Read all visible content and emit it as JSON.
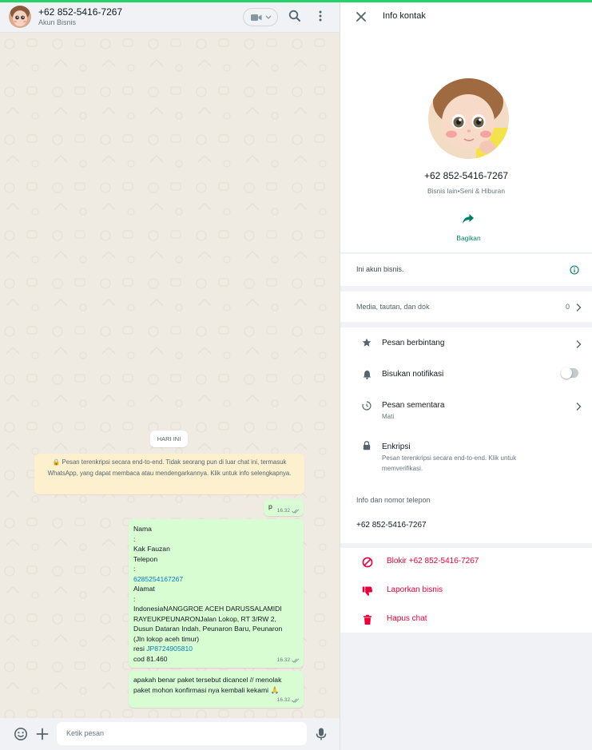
{
  "chat": {
    "header": {
      "name": "+62 852-5416-7267",
      "subtitle": "Akun Bisnis"
    },
    "date_chip": "HARI INI",
    "encryption_note": "🔒 Pesan terenkripsi secara end-to-end. Tidak seorang pun di luar chat ini, termasuk WhatsApp, yang dapat membaca atau mendengarkannya. Klik untuk info selengkapnya.",
    "messages": [
      {
        "text": "p",
        "time": "16.32"
      },
      {
        "lines": [
          "Nama",
          ":",
          "Kak Fauzan",
          "Telepon",
          ":",
          "6285254167267",
          "Alamat",
          ":",
          "IndonesiaNANGGROE ACEH DARUSSALAMIDI",
          "RAYEUKPEUNARONJalan Lokop, RT 3/RW 2,",
          "Dusun Dataran Indah, Peunaron Baru, Peunaron",
          "(Jln lokop aceh timur)",
          "resi ",
          "cod 81.460"
        ],
        "resi_code": "JP8724905810",
        "time": "16.32"
      },
      {
        "lines": [
          "apakah benar paket tersebut  dicancel // menolak",
          "paket mohon konfirmasi nya kembali kekami  🙏"
        ],
        "time": "16.32"
      }
    ],
    "input_placeholder": "Ketik pesan"
  },
  "info": {
    "title": "Info kontak",
    "profile": {
      "name": "+62 852-5416-7267",
      "category": "Bisnis lain•Seni & Hiburan",
      "share_label": "Bagikan"
    },
    "business_note": "Ini akun bisnis.",
    "media": {
      "label": "Media, tautan, dan dok",
      "count": "0"
    },
    "list": {
      "starred": "Pesan berbintang",
      "mute": "Bisukan notifikasi",
      "disappearing": "Pesan sementara",
      "disappearing_value": "Mati",
      "encryption": "Enkripsi",
      "encryption_desc_1": "Pesan terenkripsi secara end-to-end. Klik untuk",
      "encryption_desc_2": "memverifikasi.",
      "phone_section": "Info dan nomor telepon",
      "phone": "+62 852-5416-7267"
    },
    "actions": {
      "block": "Blokir +62 852-5416-7267",
      "report": "Laporkan bisnis",
      "delete": "Hapus chat"
    }
  },
  "colors": {
    "accent": "#008069",
    "danger": "#ea0038",
    "bubble_out": "#d9fdd3",
    "chat_bg": "#efeae2",
    "system_note": "#fdf0cf"
  }
}
